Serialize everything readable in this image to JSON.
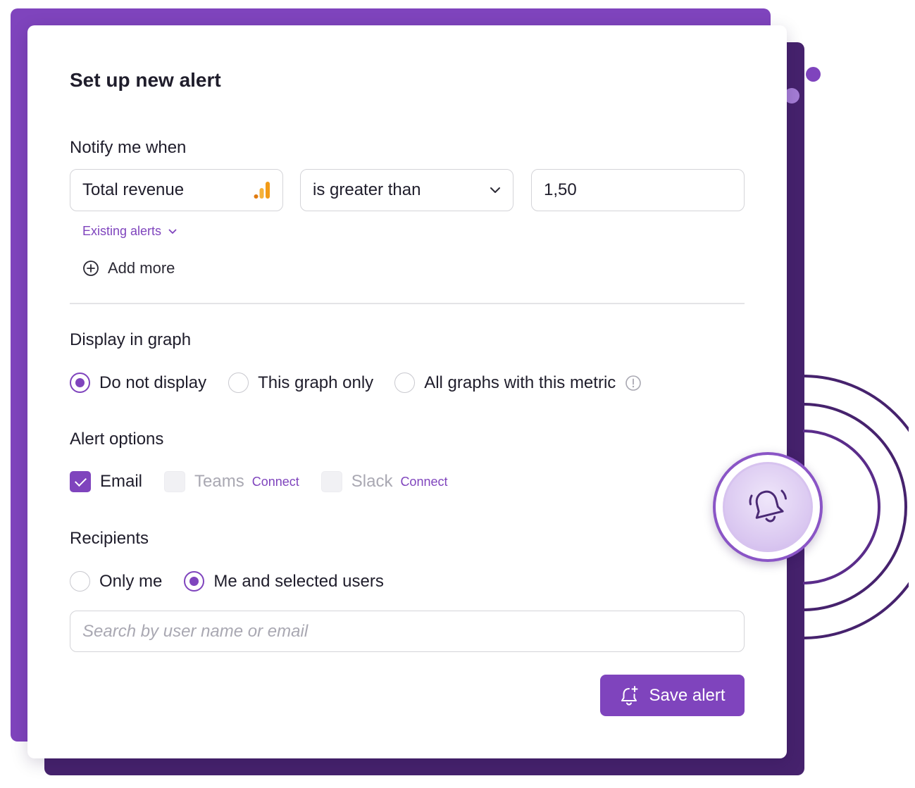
{
  "dialog": {
    "title": "Set up new alert"
  },
  "notify": {
    "label": "Notify me when",
    "metric": "Total revenue",
    "metric_icon": "bar-chart-icon",
    "condition": "is greater than",
    "value": "1,50",
    "existing_alerts": "Existing alerts",
    "add_more": "Add more"
  },
  "display": {
    "label": "Display in graph",
    "options": [
      "Do not display",
      "This graph only",
      "All graphs with this metric"
    ],
    "selected": "Do not display"
  },
  "alert_options": {
    "label": "Alert options",
    "email": "Email",
    "email_checked": true,
    "teams": "Teams",
    "teams_connect": "Connect",
    "slack": "Slack",
    "slack_connect": "Connect"
  },
  "recipients": {
    "label": "Recipients",
    "options": [
      "Only me",
      "Me and selected users"
    ],
    "selected": "Me and selected users",
    "search_placeholder": "Search by user name or email"
  },
  "save_button": "Save alert",
  "colors": {
    "accent": "#7f44bd",
    "dark_accent": "#46226d",
    "metric_icon": "#f29b17"
  }
}
